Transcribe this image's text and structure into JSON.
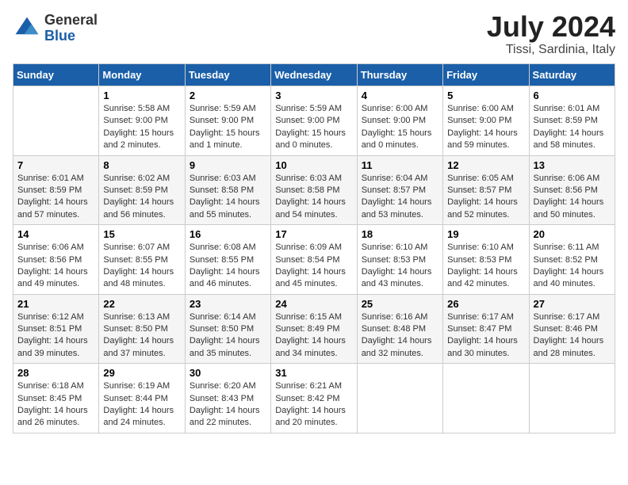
{
  "header": {
    "logo_general": "General",
    "logo_blue": "Blue",
    "month_year": "July 2024",
    "location": "Tissi, Sardinia, Italy"
  },
  "days_of_week": [
    "Sunday",
    "Monday",
    "Tuesday",
    "Wednesday",
    "Thursday",
    "Friday",
    "Saturday"
  ],
  "weeks": [
    [
      {
        "day": "",
        "info": ""
      },
      {
        "day": "1",
        "info": "Sunrise: 5:58 AM\nSunset: 9:00 PM\nDaylight: 15 hours\nand 2 minutes."
      },
      {
        "day": "2",
        "info": "Sunrise: 5:59 AM\nSunset: 9:00 PM\nDaylight: 15 hours\nand 1 minute."
      },
      {
        "day": "3",
        "info": "Sunrise: 5:59 AM\nSunset: 9:00 PM\nDaylight: 15 hours\nand 0 minutes."
      },
      {
        "day": "4",
        "info": "Sunrise: 6:00 AM\nSunset: 9:00 PM\nDaylight: 15 hours\nand 0 minutes."
      },
      {
        "day": "5",
        "info": "Sunrise: 6:00 AM\nSunset: 9:00 PM\nDaylight: 14 hours\nand 59 minutes."
      },
      {
        "day": "6",
        "info": "Sunrise: 6:01 AM\nSunset: 8:59 PM\nDaylight: 14 hours\nand 58 minutes."
      }
    ],
    [
      {
        "day": "7",
        "info": "Sunrise: 6:01 AM\nSunset: 8:59 PM\nDaylight: 14 hours\nand 57 minutes."
      },
      {
        "day": "8",
        "info": "Sunrise: 6:02 AM\nSunset: 8:59 PM\nDaylight: 14 hours\nand 56 minutes."
      },
      {
        "day": "9",
        "info": "Sunrise: 6:03 AM\nSunset: 8:58 PM\nDaylight: 14 hours\nand 55 minutes."
      },
      {
        "day": "10",
        "info": "Sunrise: 6:03 AM\nSunset: 8:58 PM\nDaylight: 14 hours\nand 54 minutes."
      },
      {
        "day": "11",
        "info": "Sunrise: 6:04 AM\nSunset: 8:57 PM\nDaylight: 14 hours\nand 53 minutes."
      },
      {
        "day": "12",
        "info": "Sunrise: 6:05 AM\nSunset: 8:57 PM\nDaylight: 14 hours\nand 52 minutes."
      },
      {
        "day": "13",
        "info": "Sunrise: 6:06 AM\nSunset: 8:56 PM\nDaylight: 14 hours\nand 50 minutes."
      }
    ],
    [
      {
        "day": "14",
        "info": "Sunrise: 6:06 AM\nSunset: 8:56 PM\nDaylight: 14 hours\nand 49 minutes."
      },
      {
        "day": "15",
        "info": "Sunrise: 6:07 AM\nSunset: 8:55 PM\nDaylight: 14 hours\nand 48 minutes."
      },
      {
        "day": "16",
        "info": "Sunrise: 6:08 AM\nSunset: 8:55 PM\nDaylight: 14 hours\nand 46 minutes."
      },
      {
        "day": "17",
        "info": "Sunrise: 6:09 AM\nSunset: 8:54 PM\nDaylight: 14 hours\nand 45 minutes."
      },
      {
        "day": "18",
        "info": "Sunrise: 6:10 AM\nSunset: 8:53 PM\nDaylight: 14 hours\nand 43 minutes."
      },
      {
        "day": "19",
        "info": "Sunrise: 6:10 AM\nSunset: 8:53 PM\nDaylight: 14 hours\nand 42 minutes."
      },
      {
        "day": "20",
        "info": "Sunrise: 6:11 AM\nSunset: 8:52 PM\nDaylight: 14 hours\nand 40 minutes."
      }
    ],
    [
      {
        "day": "21",
        "info": "Sunrise: 6:12 AM\nSunset: 8:51 PM\nDaylight: 14 hours\nand 39 minutes."
      },
      {
        "day": "22",
        "info": "Sunrise: 6:13 AM\nSunset: 8:50 PM\nDaylight: 14 hours\nand 37 minutes."
      },
      {
        "day": "23",
        "info": "Sunrise: 6:14 AM\nSunset: 8:50 PM\nDaylight: 14 hours\nand 35 minutes."
      },
      {
        "day": "24",
        "info": "Sunrise: 6:15 AM\nSunset: 8:49 PM\nDaylight: 14 hours\nand 34 minutes."
      },
      {
        "day": "25",
        "info": "Sunrise: 6:16 AM\nSunset: 8:48 PM\nDaylight: 14 hours\nand 32 minutes."
      },
      {
        "day": "26",
        "info": "Sunrise: 6:17 AM\nSunset: 8:47 PM\nDaylight: 14 hours\nand 30 minutes."
      },
      {
        "day": "27",
        "info": "Sunrise: 6:17 AM\nSunset: 8:46 PM\nDaylight: 14 hours\nand 28 minutes."
      }
    ],
    [
      {
        "day": "28",
        "info": "Sunrise: 6:18 AM\nSunset: 8:45 PM\nDaylight: 14 hours\nand 26 minutes."
      },
      {
        "day": "29",
        "info": "Sunrise: 6:19 AM\nSunset: 8:44 PM\nDaylight: 14 hours\nand 24 minutes."
      },
      {
        "day": "30",
        "info": "Sunrise: 6:20 AM\nSunset: 8:43 PM\nDaylight: 14 hours\nand 22 minutes."
      },
      {
        "day": "31",
        "info": "Sunrise: 6:21 AM\nSunset: 8:42 PM\nDaylight: 14 hours\nand 20 minutes."
      },
      {
        "day": "",
        "info": ""
      },
      {
        "day": "",
        "info": ""
      },
      {
        "day": "",
        "info": ""
      }
    ]
  ]
}
